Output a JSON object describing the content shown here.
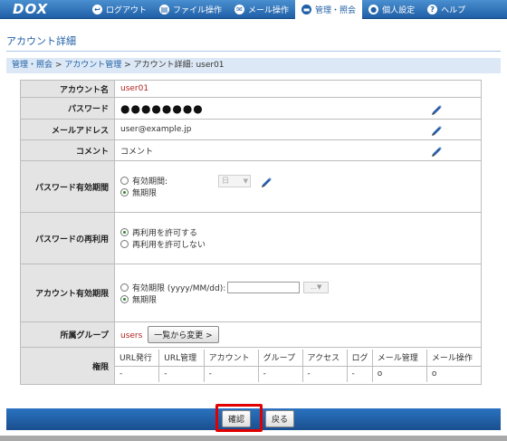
{
  "app": {
    "logo": "DOX"
  },
  "nav": [
    {
      "label": "ログアウト",
      "icon": "logout-icon",
      "glyph": "↩"
    },
    {
      "label": "ファイル操作",
      "icon": "file-icon",
      "glyph": "▤"
    },
    {
      "label": "メール操作",
      "icon": "mail-icon",
      "glyph": "✉"
    },
    {
      "label": "管理・照会",
      "icon": "admin-icon",
      "glyph": "▬"
    },
    {
      "label": "個人設定",
      "icon": "person-icon",
      "glyph": "●"
    },
    {
      "label": "ヘルプ",
      "icon": "help-icon",
      "glyph": "?"
    }
  ],
  "page": {
    "title": "アカウント詳細"
  },
  "breadcrumb": {
    "item1": "管理・照会",
    "sep1": " > ",
    "item2": "アカウント管理",
    "sep2": " > ",
    "current": "アカウント詳細: user01"
  },
  "detail": {
    "account_label": "アカウント名",
    "account_value": "user01",
    "password_label": "パスワード",
    "password_value": "●●●●●●●●",
    "email_label": "メールアドレス",
    "email_value": "user@example.jp",
    "comment_label": "コメント",
    "comment_value": "コメント",
    "pw_expiry_label": "パスワード有効期間",
    "pw_expiry_opt1": "有効期間:",
    "pw_expiry_select": "日",
    "pw_expiry_opt2": "無期限",
    "pw_reuse_label": "パスワードの再利用",
    "pw_reuse_opt1": "再利用を許可する",
    "pw_reuse_opt2": "再利用を許可しない",
    "acct_expiry_label": "アカウント有効期限",
    "acct_expiry_opt1": "有効期限 (yyyy/MM/dd):",
    "acct_expiry_input": "",
    "acct_expiry_opt2": "無期限",
    "group_label": "所属グループ",
    "group_value": "users",
    "group_button": "一覧から変更 >",
    "perm_label": "権限"
  },
  "permissions": {
    "headers": [
      "URL発行",
      "URL管理",
      "アカウント",
      "グループ",
      "アクセス",
      "ログ",
      "メール管理",
      "メール操作"
    ],
    "values": [
      "-",
      "-",
      "-",
      "-",
      "-",
      "-",
      "o",
      "o"
    ]
  },
  "footer": {
    "confirm": "確認",
    "back": "戻る"
  },
  "colors": {
    "accent": "#1f5fa6",
    "highlight": "#e00000"
  }
}
